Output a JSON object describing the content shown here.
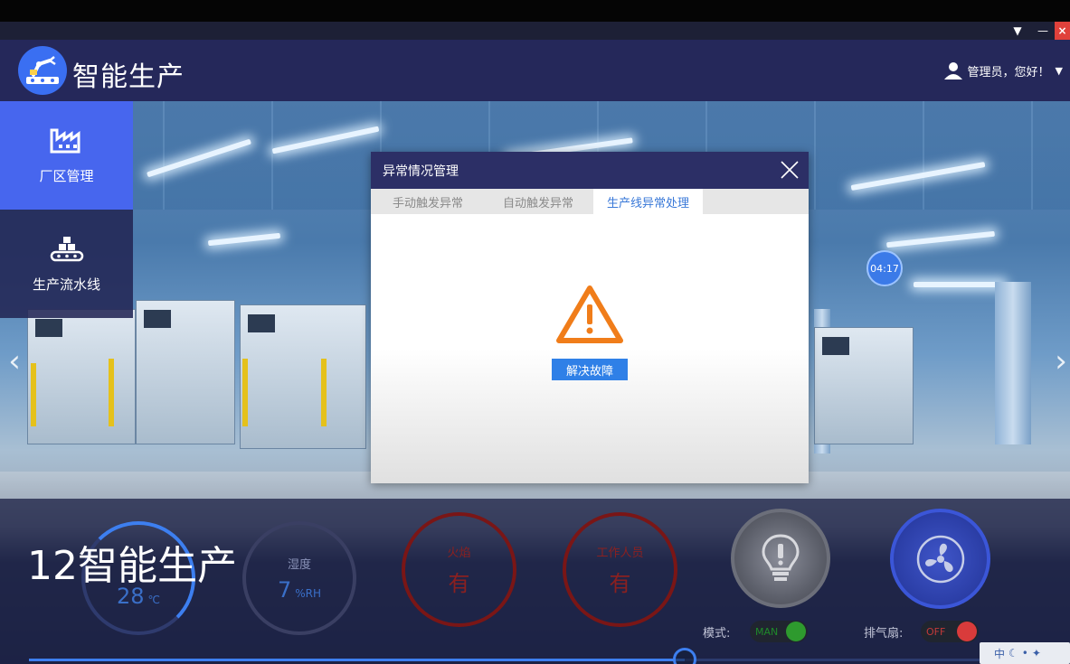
{
  "window": {
    "dropdown_glyph": "▼",
    "minimize_glyph": "—",
    "close_glyph": "×"
  },
  "header": {
    "app_title": "智能生产",
    "user_greeting": "管理员，您好！",
    "user_menu_glyph": "▼"
  },
  "sidebar": {
    "items": [
      {
        "label": "厂区管理",
        "icon": "factory-icon",
        "active": true
      },
      {
        "label": "生产流水线",
        "icon": "conveyor-icon",
        "active": false
      }
    ]
  },
  "carousel": {
    "prev_glyph": "‹",
    "next_glyph": "›"
  },
  "timestamp_bubble": "04:17",
  "dialog": {
    "title": "异常情况管理",
    "tabs": [
      {
        "label": "手动触发异常",
        "active": false
      },
      {
        "label": "自动触发异常",
        "active": false
      },
      {
        "label": "生产线异常处理",
        "active": true
      }
    ],
    "action_button": "解决故障",
    "warning_color": "#f07d1a"
  },
  "dashboard": {
    "title": "12智能生产",
    "temperature": {
      "value": "28",
      "unit": "℃"
    },
    "humidity": {
      "label": "湿度",
      "value": "7",
      "unit": "%RH"
    },
    "fire": {
      "label": "火焰",
      "value": "有"
    },
    "staff": {
      "label": "工作人员",
      "value": "有"
    },
    "mode": {
      "label": "模式:",
      "value": "MAN"
    },
    "exhaust_fan": {
      "label": "排气扇:",
      "value": "OFF"
    },
    "playback_progress": 0.63
  },
  "ime": {
    "label": "中"
  },
  "colors": {
    "header_bg": "#25285a",
    "sidebar_active": "#4766ee",
    "dialog_title_bg": "#2c2f66",
    "accent_blue": "#2f80e7",
    "alert_red": "#7a1616"
  }
}
